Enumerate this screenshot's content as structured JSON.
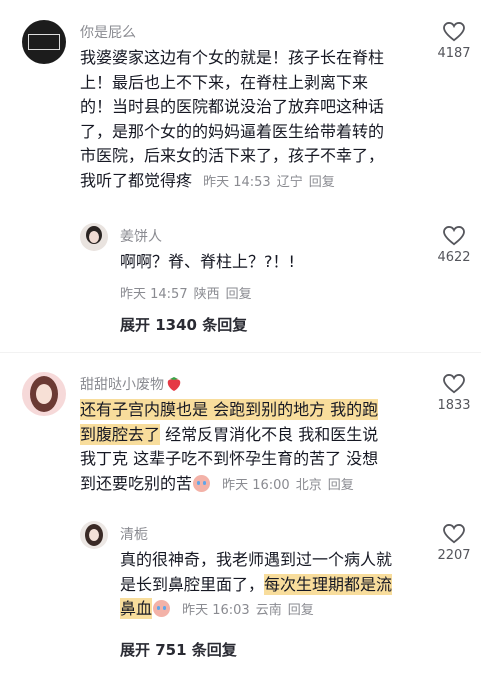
{
  "comments": [
    {
      "username": "你是屁么",
      "lines": [
        "我婆婆家这边有个女的就是！孩子长在脊柱",
        "上！最后也上不下来，在脊柱上剥离下来",
        "的！当时县的医院都说没治了放弃吧这种话",
        "了，是那个女的的妈妈逼着医生给带着转的",
        "市医院，后来女的活下来了，孩子不幸了，",
        "我听了都觉得疼"
      ],
      "time": "昨天 14:53",
      "location": "辽宁",
      "reply_label": "回复",
      "likes": "4187",
      "replies": [
        {
          "username": "姜饼人",
          "text": "啊啊？脊、脊柱上？?！!",
          "time": "昨天 14:57",
          "location": "陕西",
          "reply_label": "回复",
          "likes": "4622"
        }
      ],
      "expand_label": "展开 1340 条回复"
    },
    {
      "username": "甜甜哒小废物",
      "lines_hl": [
        "还有子宫内膜也是 会跑到别的地方 我的跑",
        "到腹腔去了"
      ],
      "line2_rest": " 经常反胃消化不良 我和医生说",
      "line3": "我丁克 这辈子吃不到怀孕生育的苦了 没想",
      "line4": "到还要吃别的苦",
      "time": "昨天 16:00",
      "location": "北京",
      "reply_label": "回复",
      "likes": "1833",
      "replies": [
        {
          "username": "清栀",
          "line1": "真的很神奇，我老师遇到过一个病人就",
          "line2_plain": "是长到鼻腔里面了，",
          "line2_hl": "每次生理期都是流",
          "line3_hl": "鼻血",
          "time": "昨天 16:03",
          "location": "云南",
          "reply_label": "回复",
          "likes": "2207"
        }
      ],
      "expand_label": "展开 751 条回复"
    }
  ],
  "colors": {
    "highlight": "#f8dd9c",
    "meta": "#8a8b91",
    "heart": "#55565c"
  }
}
